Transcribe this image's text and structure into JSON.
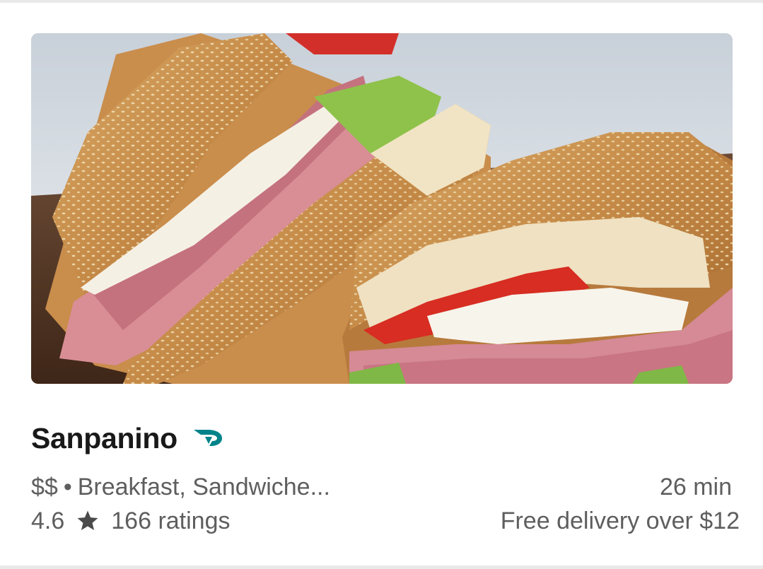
{
  "store": {
    "name": "Sanpanino",
    "price_range": "$$",
    "separator": "•",
    "cuisines": "Breakfast, Sandwiche...",
    "rating": "4.6",
    "ratings_count": "166 ratings",
    "eta": "26 min",
    "delivery_fee": "Free delivery over $12",
    "image_icon": "sandwich-photo",
    "badge_icon": "dashpass-icon",
    "rating_icon": "star-icon"
  },
  "colors": {
    "dashpass_teal": "#00838a",
    "text_primary": "#191919",
    "text_secondary": "#5e5e5e",
    "divider": "#e9e9e9"
  }
}
